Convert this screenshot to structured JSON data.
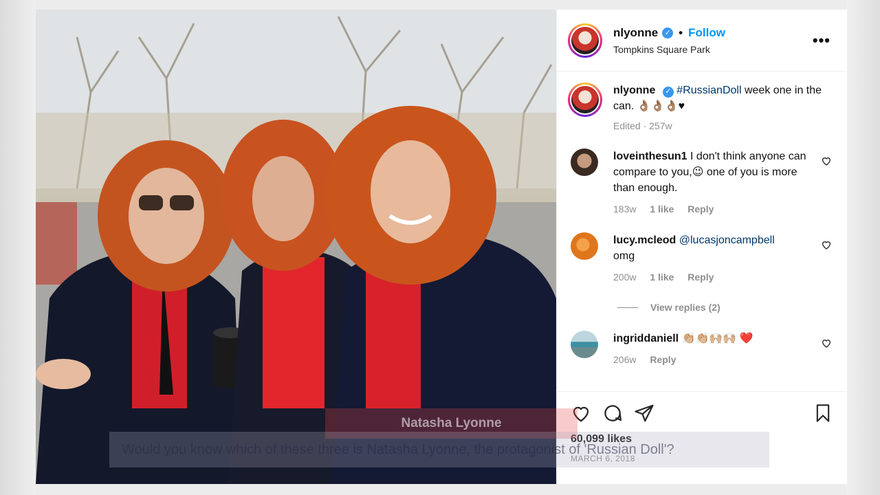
{
  "header": {
    "username": "nlyonne",
    "separator": "•",
    "follow_label": "Follow",
    "location": "Tompkins Square Park",
    "more_label": "•••"
  },
  "caption": {
    "username": "nlyonne",
    "hashtag": "#RussianDoll",
    "text": " week one in the can. 👌🏽👌🏽👌🏽♥",
    "meta": "Edited · 257w"
  },
  "comments": [
    {
      "username": "loveinthesun1",
      "text": " I don't think anyone can compare to you,😉 one of you is more than enough.",
      "time": "183w",
      "likes": "1 like",
      "reply": "Reply"
    },
    {
      "username": "lucy.mcleod",
      "mention": "@lucasjoncampbell",
      "text": "omg",
      "time": "200w",
      "likes": "1 like",
      "reply": "Reply"
    },
    {
      "username": "ingriddaniell",
      "text": " 👏🏼👏🏼🙌🏼🙌🏼 ❤️",
      "time": "206w",
      "reply": "Reply"
    }
  ],
  "view_replies": "View replies (2)",
  "likes_count": "60,099 likes",
  "date": "MARCH 6, 2018",
  "overlay": {
    "name_tag": "Natasha Lyonne",
    "subtitle": "Would you know which of these three is Natasha Lyonne, the protagonist of 'Russian Doll'?"
  },
  "colors": {
    "link_blue": "#0095f6",
    "verified_blue": "#3897f0",
    "muted_gray": "#8e8e8e",
    "heart_red": "#ed4956"
  },
  "icons": [
    "heart-icon",
    "comment-icon",
    "share-icon",
    "bookmark-icon",
    "verified-icon",
    "more-icon"
  ]
}
